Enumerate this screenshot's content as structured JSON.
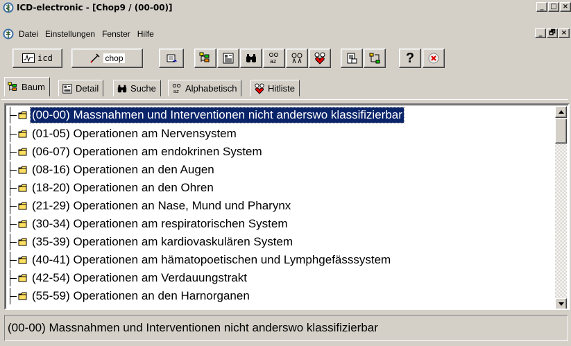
{
  "window": {
    "title": "ICD-electronic - [Chop9 / (00-00)]",
    "controls": [
      "_",
      "□",
      "×"
    ],
    "mdi_controls": [
      "_",
      "🗗",
      "×"
    ]
  },
  "menu": [
    "Datei",
    "Einstellungen",
    "Fenster",
    "Hilfe"
  ],
  "toolbar": {
    "icd_label": "icd",
    "chop_label": "chop",
    "help_label": "?",
    "icons": [
      "icd-icon",
      "chop-icon",
      "export-icon",
      "tree-view-icon",
      "detail-view-icon",
      "search-binoculars-icon",
      "alphabetic-icon",
      "glasses-icon",
      "hitlist-icon",
      "print-icon",
      "network-icon",
      "help-icon",
      "exit-icon"
    ]
  },
  "tabs": [
    {
      "label": "Baum",
      "icon": "tree-icon",
      "active": true
    },
    {
      "label": "Detail",
      "icon": "detail-icon",
      "active": false
    },
    {
      "label": "Suche",
      "icon": "binoculars-icon",
      "active": false
    },
    {
      "label": "Alphabetisch",
      "icon": "alpha-icon",
      "active": false
    },
    {
      "label": "Hitliste",
      "icon": "hitlist-icon",
      "active": false
    }
  ],
  "tree": [
    {
      "label": "(00-00) Massnahmen und Interventionen nicht anderswo klassifizierbar",
      "selected": true
    },
    {
      "label": "(01-05) Operationen am Nervensystem"
    },
    {
      "label": "(06-07) Operationen am endokrinen System"
    },
    {
      "label": "(08-16) Operationen an den Augen"
    },
    {
      "label": "(18-20) Operationen an den Ohren"
    },
    {
      "label": "(21-29) Operationen an Nase, Mund und Pharynx"
    },
    {
      "label": "(30-34) Operationen am respiratorischen System"
    },
    {
      "label": "(35-39) Operationen am kardiovaskulären System"
    },
    {
      "label": "(40-41) Operationen am hämatopoetischen und Lymphgefässsystem"
    },
    {
      "label": "(42-54) Operationen am Verdauungstrakt"
    },
    {
      "label": "(55-59) Operationen an den Harnorganen"
    }
  ],
  "status": "(00-00) Massnahmen und Interventionen nicht anderswo klassifizierbar"
}
